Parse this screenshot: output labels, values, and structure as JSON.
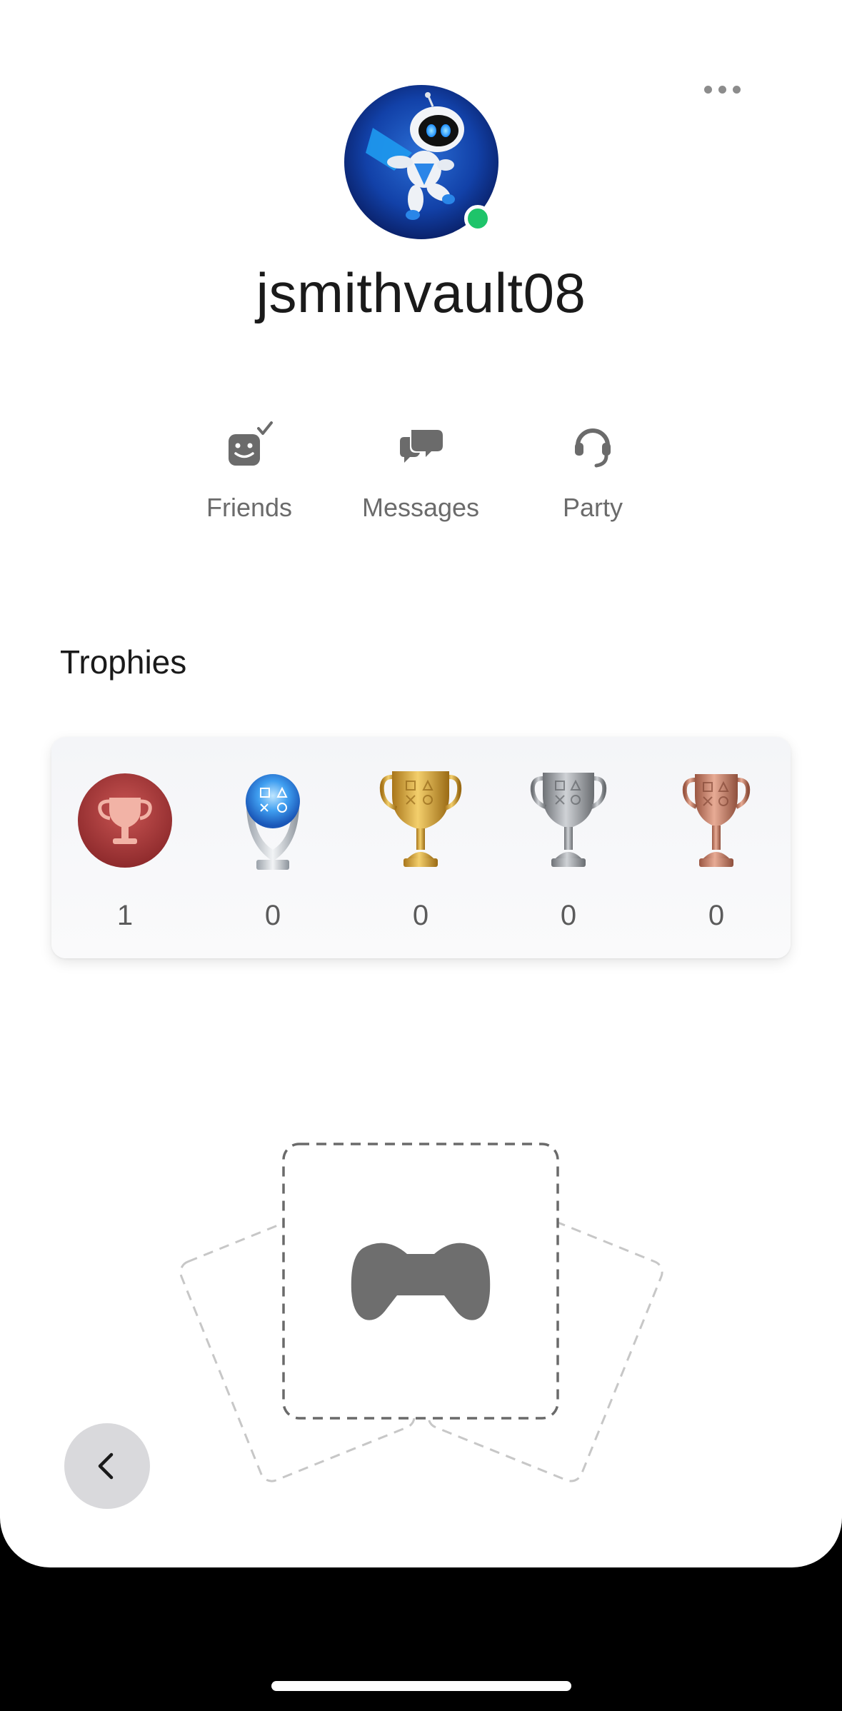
{
  "profile": {
    "username": "jsmithvault08",
    "online_status": "online",
    "online_color": "#1ec46a",
    "avatar_icon": "astro-bot-avatar"
  },
  "header": {
    "more_icon": "more-horizontal-icon"
  },
  "actions": [
    {
      "label": "Friends",
      "icon": "friends-icon"
    },
    {
      "label": "Messages",
      "icon": "messages-icon"
    },
    {
      "label": "Party",
      "icon": "headset-icon"
    }
  ],
  "trophies": {
    "title": "Trophies",
    "items": [
      {
        "type": "trophy-level",
        "count": "1",
        "color": "#b8403f"
      },
      {
        "type": "platinum",
        "count": "0",
        "color": "#5aa9ea"
      },
      {
        "type": "gold",
        "count": "0",
        "color": "#d4a43a"
      },
      {
        "type": "silver",
        "count": "0",
        "color": "#9ea0a4"
      },
      {
        "type": "bronze",
        "count": "0",
        "color": "#c98670"
      }
    ]
  },
  "games_placeholder": {
    "icon": "game-controller-icon"
  },
  "navigation": {
    "back_icon": "chevron-left-icon"
  }
}
